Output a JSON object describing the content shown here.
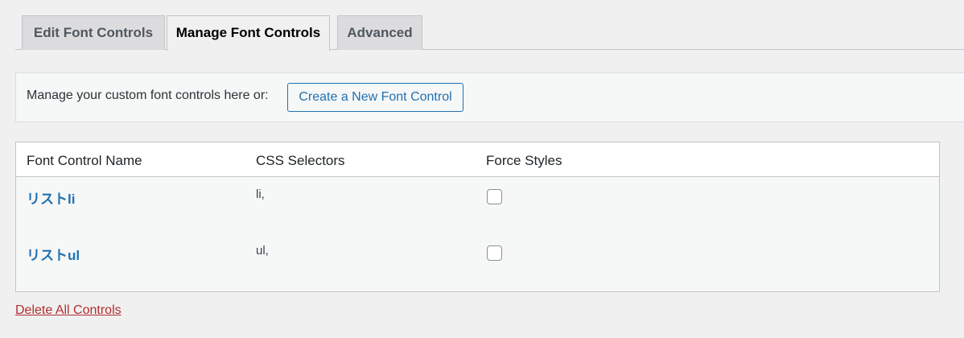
{
  "tabs": [
    {
      "label": "Edit Font Controls",
      "active": false
    },
    {
      "label": "Manage Font Controls",
      "active": true
    },
    {
      "label": "Advanced",
      "active": false
    }
  ],
  "notice": {
    "text": "Manage your custom font controls here or:",
    "button_label": "Create a New Font Control"
  },
  "table": {
    "columns": [
      "Font Control Name",
      "CSS Selectors",
      "Force Styles"
    ],
    "rows": [
      {
        "name": "リストli",
        "selectors": "li,",
        "force_styles": false
      },
      {
        "name": "リストul",
        "selectors": "ul,",
        "force_styles": false
      }
    ]
  },
  "footer": {
    "delete_label": "Delete All Controls"
  },
  "colors": {
    "link": "#2271b1",
    "danger": "#b32d2e",
    "background": "#f0f0f1"
  }
}
